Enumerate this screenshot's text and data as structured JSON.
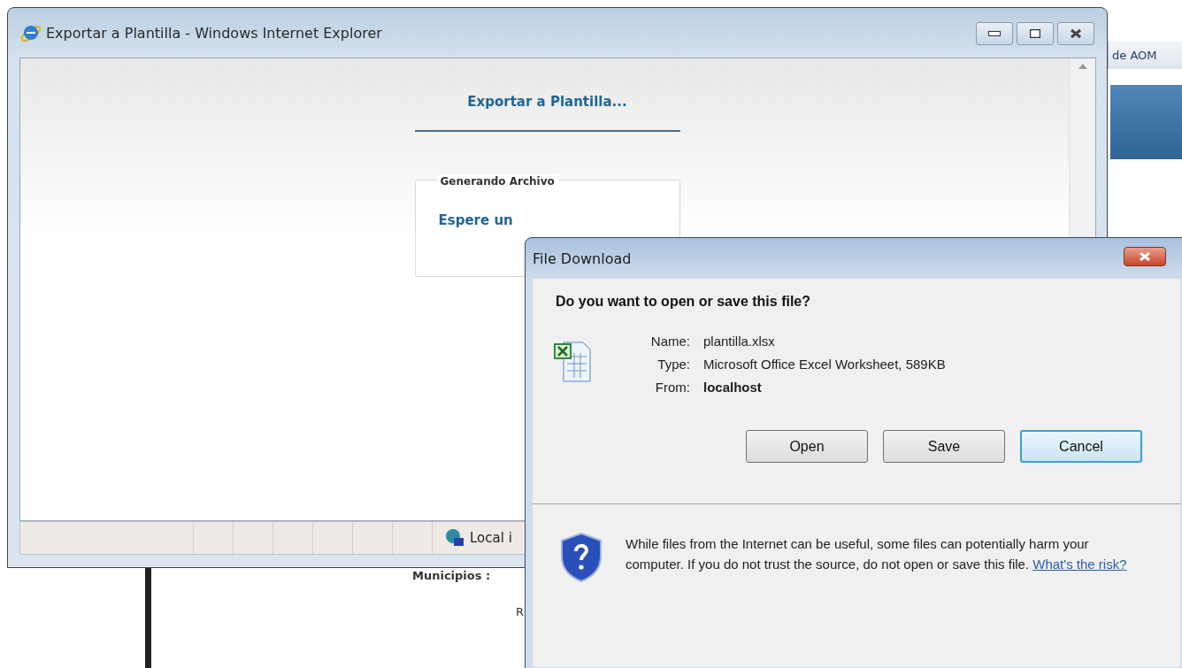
{
  "background_page": {
    "tab_label": "de AOM",
    "field_label": "Municipios :",
    "cut_label": "R"
  },
  "browser_window": {
    "title": "Exportar a Plantilla - Windows Internet Explorer",
    "heading": "Exportar a Plantilla...",
    "fieldset": {
      "legend": "Generando Archivo",
      "message": "Espere un"
    },
    "status_bar": {
      "zone": "Local i"
    }
  },
  "dialog": {
    "title": "File Download",
    "question": "Do you want to open or save this file?",
    "fields": [
      {
        "label": "Name:",
        "value": "plantilla.xlsx",
        "bold": false
      },
      {
        "label": "Type:",
        "value": "Microsoft Office Excel Worksheet, 589KB",
        "bold": false
      },
      {
        "label": "From:",
        "value": "localhost",
        "bold": true
      }
    ],
    "buttons": [
      {
        "label": "Open",
        "focused": false
      },
      {
        "label": "Save",
        "focused": false
      },
      {
        "label": "Cancel",
        "focused": true
      }
    ],
    "warning": {
      "text": "While files from the Internet can be useful, some files can potentially harm your computer. If you do not trust the source, do not open or save this file.",
      "link": "What's the risk?"
    }
  }
}
